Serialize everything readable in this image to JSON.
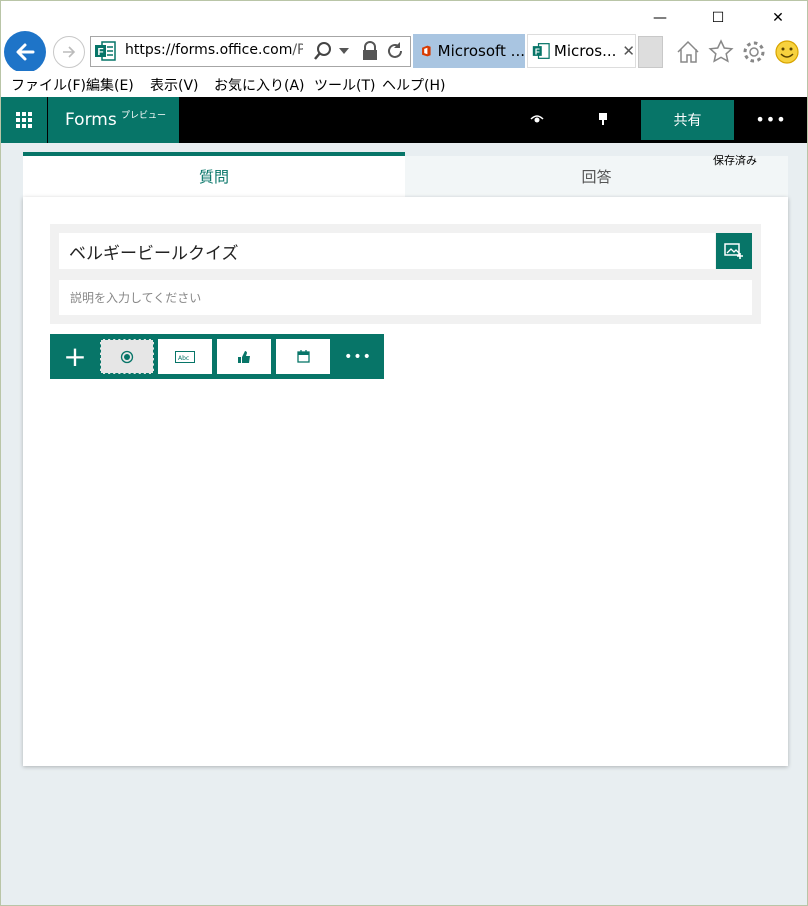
{
  "window": {
    "minimize": "—",
    "maximize": "☐",
    "close": "✕"
  },
  "browser": {
    "url_host": "https://forms.",
    "url_domain": "office.com",
    "url_path": "/Pa",
    "tabs": [
      {
        "label": "Microsoft ..."
      },
      {
        "label": "Micros...",
        "close": "✕"
      }
    ],
    "menu": [
      "ファイル(F)",
      "編集(E)",
      "表示(V)",
      "お気に入り(A)",
      "ツール(T)",
      "ヘルプ(H)"
    ]
  },
  "app": {
    "name": "Forms",
    "badge": "プレビュー",
    "share_label": "共有",
    "more_label": "•••",
    "saved_status": "保存済み"
  },
  "tabs": {
    "questions": "質問",
    "responses": "回答"
  },
  "form": {
    "title": "ベルギービールクイズ",
    "description_placeholder": "説明を入力してください"
  },
  "toolbar": {
    "add": "+",
    "more": "•••",
    "types": [
      "choice-icon",
      "text-icon",
      "rating-icon",
      "date-icon"
    ],
    "selected_index": 0
  },
  "colors": {
    "accent": "#077568",
    "header": "#000000",
    "ie_blue": "#1e74c8",
    "office_orange": "#d83b01"
  }
}
